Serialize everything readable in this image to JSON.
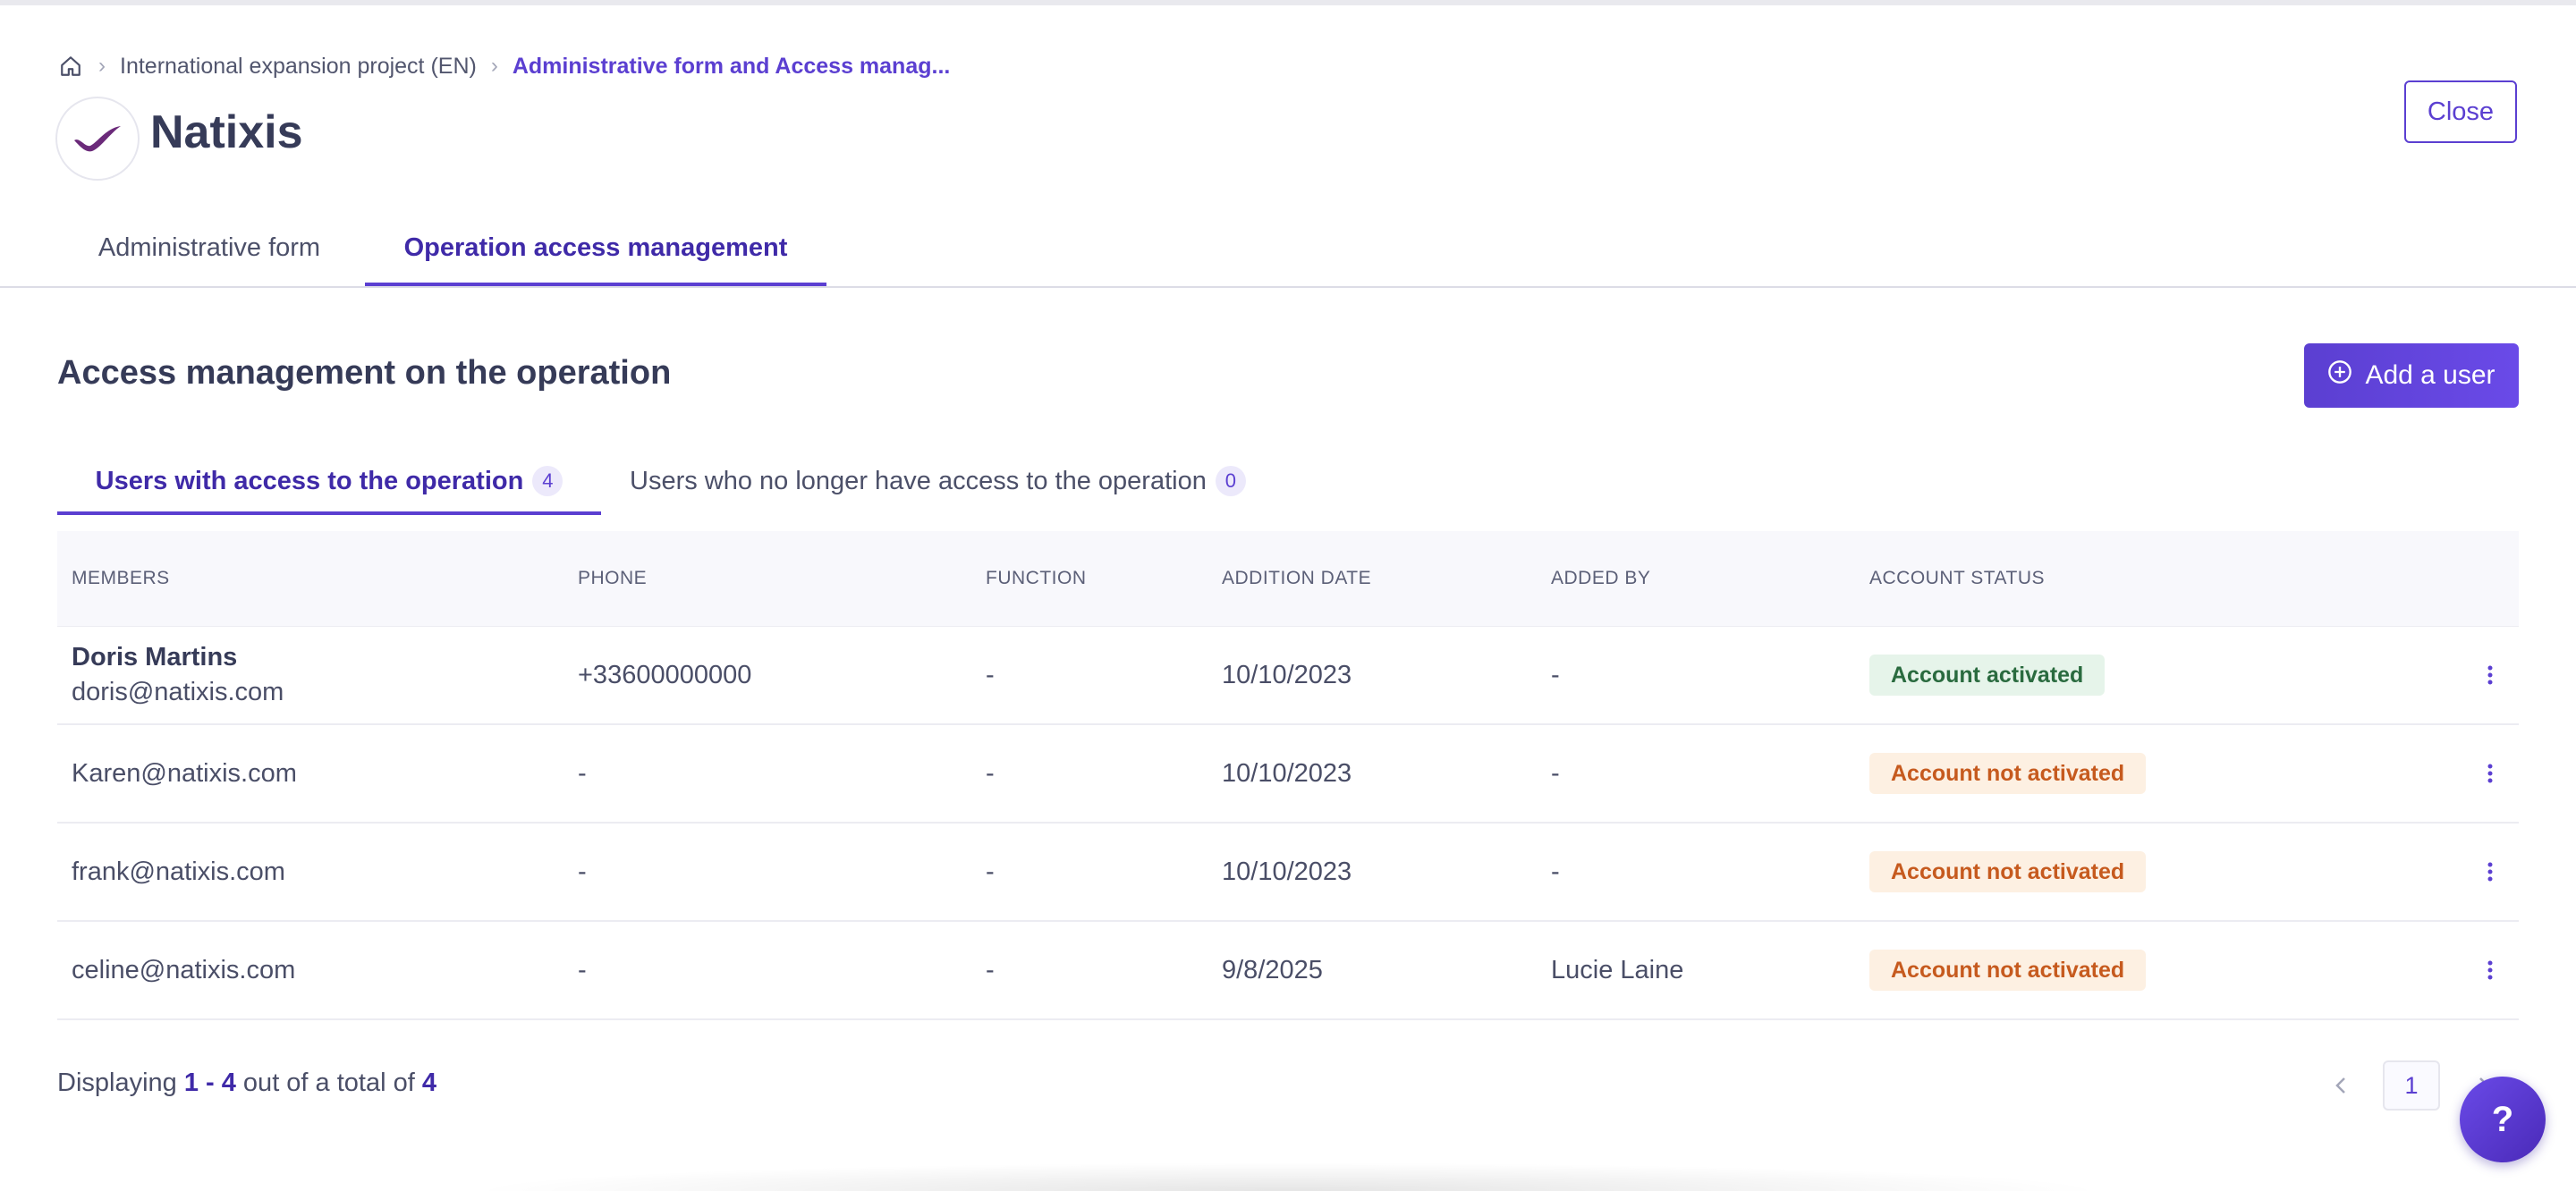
{
  "breadcrumb": {
    "items": [
      "International expansion project (EN)",
      "Administrative form and Access manag..."
    ]
  },
  "header": {
    "company": "Natixis",
    "close_label": "Close"
  },
  "main_tabs": [
    {
      "label": "Administrative form"
    },
    {
      "label": "Operation access management"
    }
  ],
  "section": {
    "title": "Access management on the operation",
    "add_label": "Add a user"
  },
  "sub_tabs": [
    {
      "label": "Users with access to the operation",
      "count": "4"
    },
    {
      "label": "Users who no longer have access to the operation",
      "count": "0"
    }
  ],
  "table": {
    "columns": [
      "MEMBERS",
      "PHONE",
      "FUNCTION",
      "ADDITION DATE",
      "ADDED BY",
      "ACCOUNT STATUS"
    ],
    "rows": [
      {
        "name": "Doris Martins",
        "email": "doris@natixis.com",
        "phone": "+33600000000",
        "function": "-",
        "date": "10/10/2023",
        "added_by": "-",
        "status": "Account activated"
      },
      {
        "name": "",
        "email": "Karen@natixis.com",
        "phone": "-",
        "function": "-",
        "date": "10/10/2023",
        "added_by": "-",
        "status": "Account not activated"
      },
      {
        "name": "",
        "email": "frank@natixis.com",
        "phone": "-",
        "function": "-",
        "date": "10/10/2023",
        "added_by": "-",
        "status": "Account not activated"
      },
      {
        "name": "",
        "email": "celine@natixis.com",
        "phone": "-",
        "function": "-",
        "date": "9/8/2025",
        "added_by": "Lucie Laine",
        "status": "Account not activated"
      }
    ]
  },
  "footer": {
    "prefix": "Displaying ",
    "range": "1 - 4",
    "middle": " out of a total of ",
    "total": "4",
    "page": "1"
  },
  "help_label": "?",
  "colors": {
    "accent": "#5b3fd1",
    "activated_bg": "#e6f4ea",
    "activated_text": "#2a6b3f",
    "not_activated_bg": "#fdf0e2",
    "not_activated_text": "#c65a1e"
  },
  "icons": [
    "home-icon",
    "chevron-right-icon",
    "natixis-logo",
    "plus-circle-icon",
    "more-vertical-icon",
    "chevron-left-icon",
    "help-icon"
  ]
}
